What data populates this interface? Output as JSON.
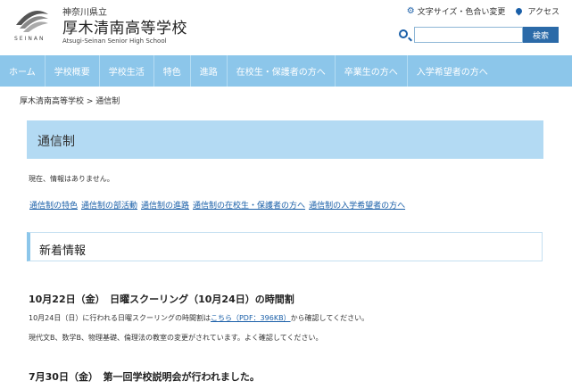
{
  "header": {
    "logo_text": "SEINAN",
    "prefecture": "神奈川県立",
    "school_name": "厚木清南高等学校",
    "school_name_en": "Atsugi-Seinan Senior High School",
    "top_links": {
      "accessibility": "文字サイズ・色合い変更",
      "access": "アクセス"
    },
    "search": {
      "placeholder": "",
      "button_label": "検索"
    }
  },
  "nav": {
    "items": [
      "ホーム",
      "学校概要",
      "学校生活",
      "特色",
      "進路",
      "在校生・保護者の方へ",
      "卒業生の方へ",
      "入学希望者の方へ"
    ]
  },
  "breadcrumb": "厚木清南高等学校 > 通信制",
  "main": {
    "page_title": "通信制",
    "notice": "現在、情報はありません。",
    "sublinks": [
      "通信制の特色",
      "通信制の部活動",
      "通信制の進路",
      "通信制の在校生・保護者の方へ",
      "通信制の入学希望者の方へ"
    ],
    "news_heading": "新着情報",
    "articles": [
      {
        "title": "10月22日（金）　日曜スクーリング（10月24日）の時間割",
        "line1_prefix": "10月24日（日）に行われる日曜スクーリングの時間割は",
        "line1_link": "こちら（PDF：396KB）",
        "line1_suffix": "から確認してください。",
        "line2": "現代文B、数学B、物理基礎、倫理法の教室の変更がされています。よく確認してください。"
      },
      {
        "title": "7月30日（金）　第一回学校説明会が行われました。"
      }
    ]
  },
  "colors": {
    "nav_bg": "#8cc6ea",
    "title_bg": "#b3daf3",
    "link": "#1a5fa8",
    "search_button": "#2b6aa8"
  }
}
